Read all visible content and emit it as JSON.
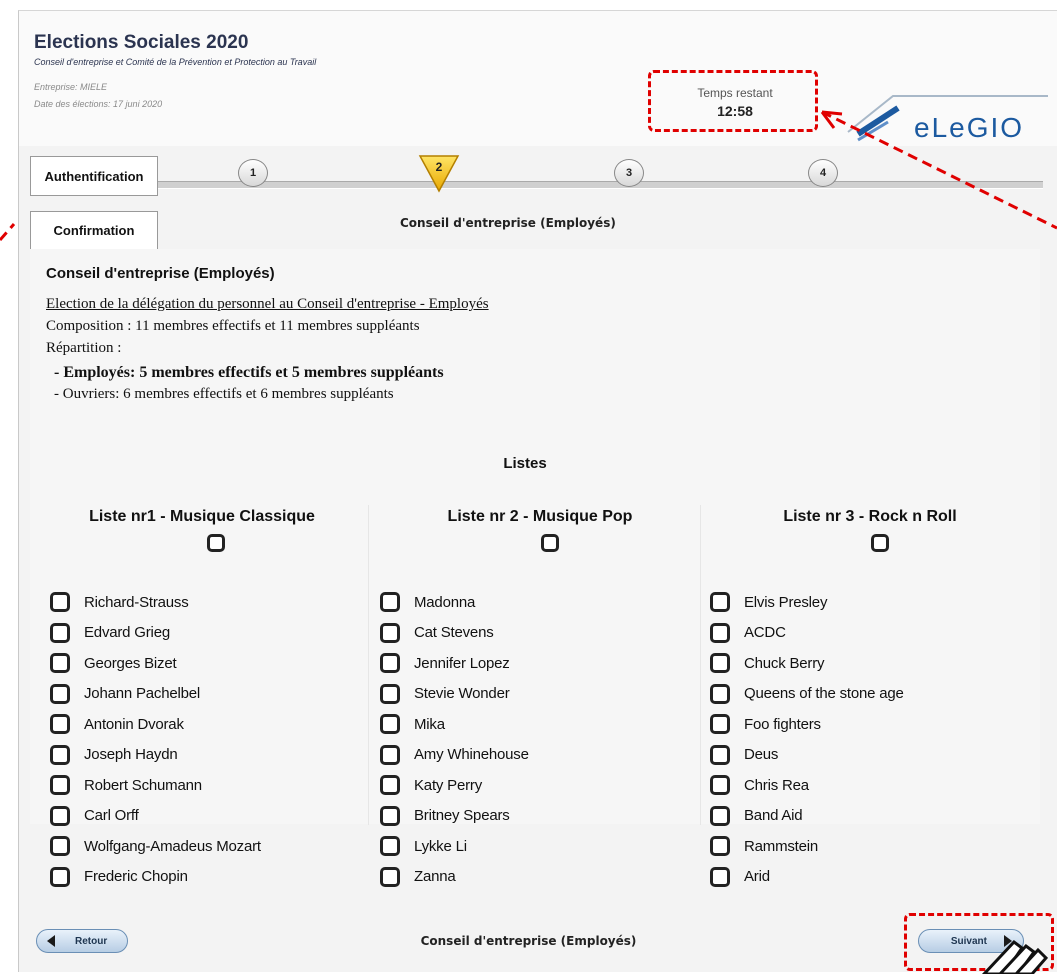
{
  "header": {
    "title": "Elections Sociales 2020",
    "subtitle": "Conseil d'entreprise et Comité de la Prévention et Protection au Travail",
    "company": "Entreprise: MIELE",
    "date": "Date des élections: 17 juni 2020",
    "timer_label": "Temps restant",
    "timer_value": "12:58",
    "logo_text": "eLeGIO"
  },
  "steps": {
    "tab_auth": "Authentification",
    "tab_confirm": "Confirmation",
    "items": [
      "1",
      "2",
      "3",
      "4"
    ],
    "active": "2",
    "section_label": "Conseil d'entreprise (Employés)"
  },
  "content": {
    "title": "Conseil d'entreprise (Employés)",
    "election_link": "Election de la délégation du personnel au Conseil d'entreprise - Employés",
    "composition": "Composition : 11 membres effectifs et 11 membres suppléants",
    "repartition": "Répartition :",
    "employes": "- Employés: 5 membres effectifs et 5 membres suppléants",
    "ouvriers": "- Ouvriers: 6 membres effectifs et 6 membres suppléants",
    "listes_title": "Listes"
  },
  "lists": [
    {
      "title": "Liste nr1 - Musique Classique",
      "candidates": [
        "Richard-Strauss",
        "Edvard Grieg",
        "Georges Bizet",
        "Johann Pachelbel",
        "Antonin Dvorak",
        "Joseph Haydn",
        "Robert Schumann",
        "Carl Orff",
        "Wolfgang-Amadeus Mozart",
        "Frederic Chopin"
      ]
    },
    {
      "title": "Liste nr 2 - Musique Pop",
      "candidates": [
        "Madonna",
        "Cat Stevens",
        "Jennifer Lopez",
        "Stevie Wonder",
        "Mika",
        "Amy Whinehouse",
        "Katy Perry",
        "Britney Spears",
        "Lykke Li",
        "Zanna"
      ]
    },
    {
      "title": "Liste nr 3 - Rock n Roll",
      "candidates": [
        "Elvis Presley",
        "ACDC",
        "Chuck Berry",
        "Queens of the stone age",
        "Foo fighters",
        "Deus",
        "Chris Rea",
        "Band Aid",
        "Rammstein",
        "Arid"
      ]
    }
  ],
  "footer": {
    "back_label": "Retour",
    "next_label": "Suivant",
    "section_label": "Conseil d'entreprise (Employés)"
  },
  "colors": {
    "highlight": "#e00000",
    "title": "#2b3450",
    "active_step": "#f5c400",
    "logo": "#1c5aa0"
  }
}
